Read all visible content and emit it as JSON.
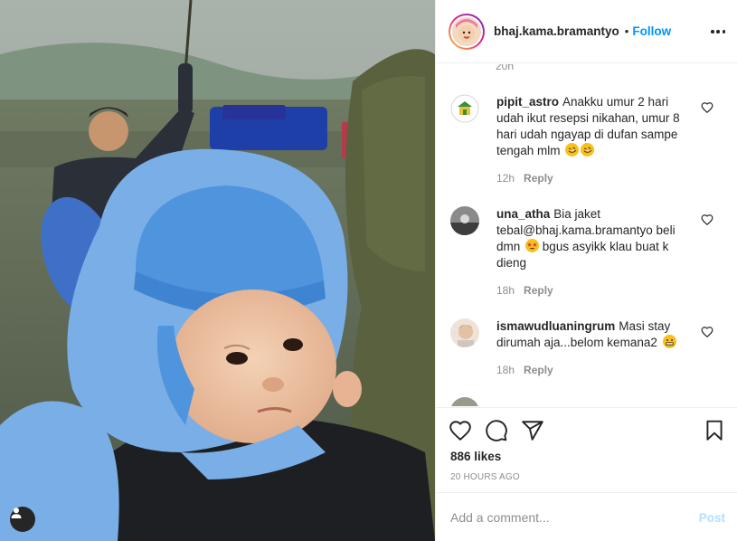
{
  "post": {
    "username": "bhaj.kama.bramantyo",
    "separator": "•",
    "follow_label": "Follow"
  },
  "comments": {
    "previous_time": "20h",
    "items": [
      {
        "username": "pipit_astro",
        "text": "Anakku umur 2 hari udah ikut resepsi nikahan, umur 8 hari udah ngayap di dufan sampe tengah mlm",
        "emoji": [
          "rolling-on-floor-laughing-emoji",
          "rolling-on-floor-laughing-emoji"
        ],
        "time": "12h",
        "reply_label": "Reply"
      },
      {
        "username": "una_atha",
        "text_before": "Bia jaket tebal@bhaj.kama.bramantyo beli dmn",
        "text_after": "bgus asyikk klau buat k dieng",
        "emoji": [
          "star-struck-emoji"
        ],
        "time": "18h",
        "reply_label": "Reply"
      },
      {
        "username": "ismawudluaningrum",
        "text": "Masi stay dirumah aja...belom kemana2",
        "emoji": [
          "grimacing-emoji"
        ],
        "time": "18h",
        "reply_label": "Reply"
      }
    ]
  },
  "actions": {
    "likes": "886 likes",
    "time_ago": "20 HOURS AGO"
  },
  "add_comment": {
    "placeholder": "Add a comment...",
    "post_label": "Post"
  },
  "colors": {
    "accent": "#0095f6",
    "post_disabled": "#b2dffc",
    "text": "#262626",
    "muted": "#8e8e8e"
  }
}
